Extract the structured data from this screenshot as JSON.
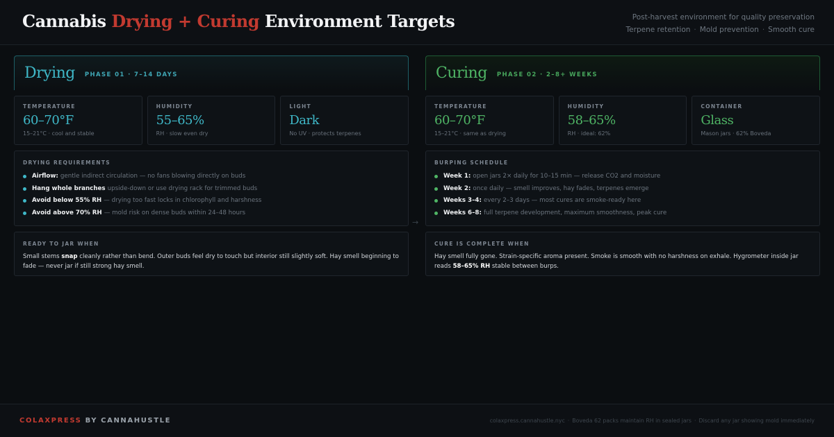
{
  "header": {
    "title_pre": "Cannabis ",
    "title_accent": "Drying + Curing",
    "title_post": " Environment Targets",
    "subtitle_line1": "Post-harvest environment for quality preservation",
    "subtitle_tags": [
      "Terpene retention",
      "Mold prevention",
      "Smooth cure"
    ],
    "separator": "·"
  },
  "drying": {
    "name": "Drying",
    "tag": "PHASE 01 · 7–14 DAYS",
    "stats": [
      {
        "label": "TEMPERATURE",
        "value": "60–70°F",
        "note": "15–21°C · cool and stable"
      },
      {
        "label": "HUMIDITY",
        "value": "55–65%",
        "note": "RH · slow even dry"
      },
      {
        "label": "LIGHT",
        "value": "Dark",
        "note": "No UV · protects terpenes"
      }
    ],
    "requirements_label": "DRYING REQUIREMENTS",
    "requirements": [
      {
        "key": "Airflow:",
        "text": "gentle indirect circulation — no fans blowing directly on buds"
      },
      {
        "key": "Hang whole branches",
        "text": "upside-down or use drying rack for trimmed buds"
      },
      {
        "key": "Avoid below 55% RH",
        "text": "— drying too fast locks in chlorophyll and harshness"
      },
      {
        "key": "Avoid above 70% RH",
        "text": "— mold risk on dense buds within 24–48 hours"
      }
    ],
    "ready_label": "READY TO JAR WHEN",
    "ready_pre": "Small stems ",
    "ready_bold": "snap",
    "ready_post": " cleanly rather than bend. Outer buds feel dry to touch but interior still slightly soft. Hay smell beginning to fade — never jar if still strong hay smell."
  },
  "curing": {
    "name": "Curing",
    "tag": "PHASE 02 · 2–8+ WEEKS",
    "stats": [
      {
        "label": "TEMPERATURE",
        "value": "60–70°F",
        "note": "15–21°C · same as drying"
      },
      {
        "label": "HUMIDITY",
        "value": "58–65%",
        "note": "RH · ideal: 62%"
      },
      {
        "label": "CONTAINER",
        "value": "Glass",
        "note": "Mason jars · 62% Boveda"
      }
    ],
    "requirements_label": "BURPING SCHEDULE",
    "requirements": [
      {
        "key": "Week 1:",
        "text": "open jars 2× daily for 10–15 min — release CO2 and moisture"
      },
      {
        "key": "Week 2:",
        "text": "once daily — smell improves, hay fades, terpenes emerge"
      },
      {
        "key": "Weeks 3–4:",
        "text": "every 2–3 days — most cures are smoke-ready here"
      },
      {
        "key": "Weeks 6–8:",
        "text": "full terpene development, maximum smoothness, peak cure"
      }
    ],
    "ready_label": "CURE IS COMPLETE WHEN",
    "ready_pre": "Hay smell fully gone. Strain-specific aroma present. Smoke is smooth with no harshness on exhale. Hygrometer inside jar reads ",
    "ready_bold": "58–65% RH",
    "ready_post": " stable between burps."
  },
  "arrow": "→",
  "footer": {
    "brand_accent": "COLAXPRESS",
    "brand_rest": " BY CANNAHUSTLE",
    "notes": [
      "colaxpress.cannahustle.nyc",
      "Boveda 62 packs maintain RH in sealed jars",
      "Discard any jar showing mold immediately"
    ]
  },
  "colors": {
    "background": "#0b0e11",
    "drying_accent": "#3fb8c8",
    "curing_accent": "#4fb565",
    "brand_red": "#c23a30"
  }
}
